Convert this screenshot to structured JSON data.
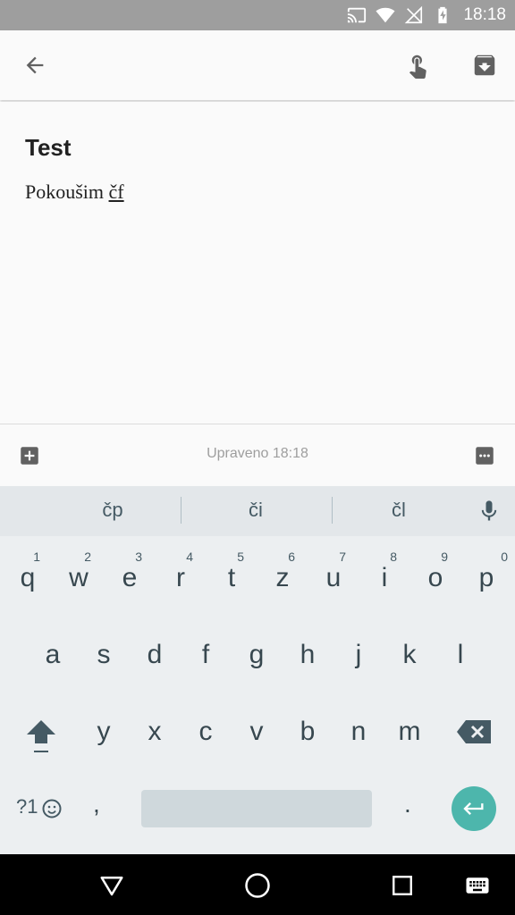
{
  "status_bar": {
    "time": "18:18",
    "icons": [
      "cast-icon",
      "wifi-icon",
      "no-signal-icon",
      "battery-charging-icon"
    ]
  },
  "toolbar": {
    "back_icon": "arrow-back-icon",
    "touch_icon": "touch-app-icon",
    "archive_icon": "archive-icon"
  },
  "note": {
    "title": "Test",
    "body_prefix": "Pokoušim ",
    "body_composing": "čf"
  },
  "bottom_bar": {
    "edited_label": "Upraveno 18:18",
    "add_icon": "add-box-icon",
    "more_icon": "more-horiz-icon"
  },
  "keyboard": {
    "suggestions": [
      "čp",
      "či",
      "čl"
    ],
    "row1": [
      {
        "label": "q",
        "hint": "1"
      },
      {
        "label": "w",
        "hint": "2"
      },
      {
        "label": "e",
        "hint": "3"
      },
      {
        "label": "r",
        "hint": "4"
      },
      {
        "label": "t",
        "hint": "5"
      },
      {
        "label": "z",
        "hint": "6"
      },
      {
        "label": "u",
        "hint": "7"
      },
      {
        "label": "i",
        "hint": "8"
      },
      {
        "label": "o",
        "hint": "9"
      },
      {
        "label": "p",
        "hint": "0"
      }
    ],
    "row2": [
      "a",
      "s",
      "d",
      "f",
      "g",
      "h",
      "j",
      "k",
      "l"
    ],
    "row3": [
      "y",
      "x",
      "c",
      "v",
      "b",
      "n",
      "m"
    ],
    "symbols_label": "?1",
    "comma": ",",
    "period": ".",
    "accent_color": "#4db6ac"
  },
  "nav_bar": {
    "icons": [
      "back-triangle-icon",
      "home-circle-icon",
      "recents-square-icon",
      "keyboard-switch-icon"
    ]
  }
}
